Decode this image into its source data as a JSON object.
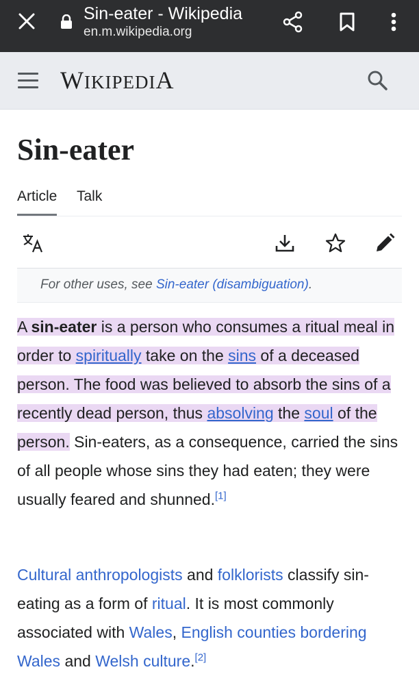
{
  "browser": {
    "title": "Sin-eater - Wikipedia",
    "url": "en.m.wikipedia.org",
    "icons": [
      "close-icon",
      "lock-icon",
      "share-icon",
      "bookmark-icon",
      "more-vert-icon"
    ]
  },
  "header": {
    "wordmark_first": "W",
    "wordmark_mid": "IKIPEDI",
    "wordmark_last": "A",
    "icons": [
      "hamburger-menu-icon",
      "search-icon"
    ]
  },
  "article": {
    "title": "Sin-eater",
    "tabs": [
      {
        "label": "Article",
        "active": true
      },
      {
        "label": "Talk",
        "active": false
      }
    ],
    "actions": [
      "language-icon",
      "download-icon",
      "watch-star-icon",
      "edit-pencil-icon"
    ],
    "hatnote": {
      "prefix": "For other uses, see ",
      "link": "Sin-eater (disambiguation)",
      "suffix": "."
    },
    "p1": {
      "t1": "A ",
      "bold": "sin-eater",
      "t2": " is a person who consumes a ritual meal in order to ",
      "link1": "spiritually",
      "t3": " take on the ",
      "link2": "sins",
      "t4": " of a deceased person. The food was believed to absorb the sins of a recently dead person, thus ",
      "link3": "absolving",
      "t5": " the ",
      "link4": "soul",
      "t6": " of the person.",
      "t7": " Sin-eaters, as a consequence, carried the sins of all people whose sins they had eaten; they were usually feared and shunned.",
      "ref": "[1]"
    },
    "p2": {
      "link1": "Cultural anthropologists",
      "t1": " and ",
      "link2": "folklorists",
      "t2": " classify sin-eating as a form of ",
      "link3": "ritual",
      "t3": ". It is most commonly associated with ",
      "link4": "Wales",
      "t4": ", ",
      "link5": "English counties bordering Wales",
      "t5": " and ",
      "link6": "Welsh culture",
      "t6": ".",
      "ref": "[2]"
    }
  },
  "colors": {
    "topbar": "#2d2e30",
    "header": "#eaecf0",
    "link": "#3366cc",
    "highlight": "#ead8f3"
  }
}
